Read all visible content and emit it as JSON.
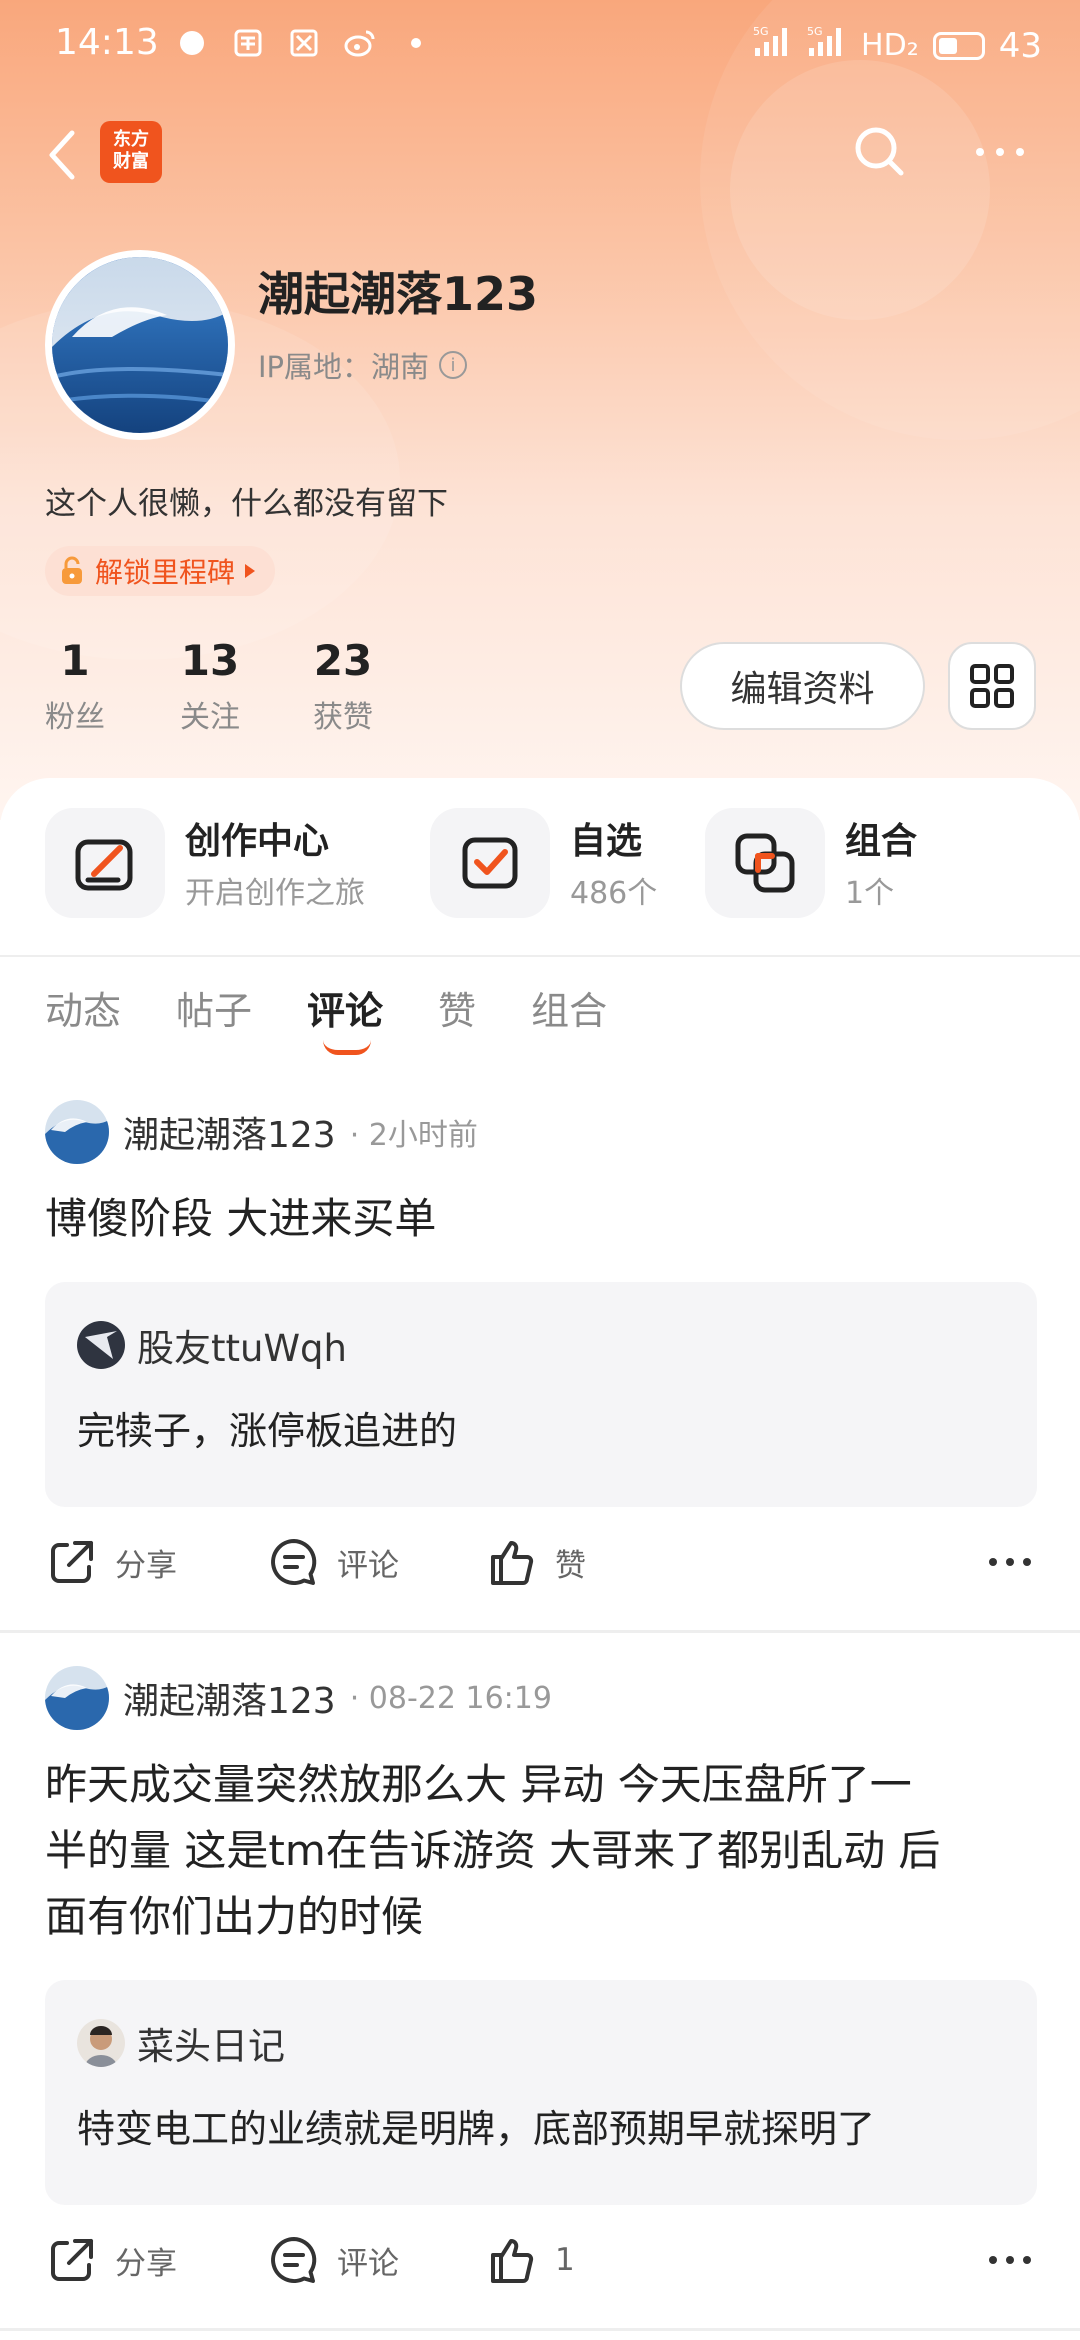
{
  "status_bar": {
    "time": "14:13",
    "net1": "5G",
    "net2": "5G",
    "hd": "HD₂",
    "battery": "43"
  },
  "brand": {
    "logo_line1": "东方",
    "logo_line2": "财富"
  },
  "profile": {
    "username": "潮起潮落123",
    "ip_location": "IP属地：湖南",
    "bio": "这个人很懒，什么都没有留下",
    "milestone": "解锁里程碑"
  },
  "stats": [
    {
      "num": "1",
      "label": "粉丝"
    },
    {
      "num": "13",
      "label": "关注"
    },
    {
      "num": "23",
      "label": "获赞"
    }
  ],
  "buttons": {
    "edit_profile": "编辑资料"
  },
  "quick": [
    {
      "title": "创作中心",
      "sub": "开启创作之旅"
    },
    {
      "title": "自选",
      "sub": "486个"
    },
    {
      "title": "组合",
      "sub": "1个"
    }
  ],
  "tabs": [
    "动态",
    "帖子",
    "评论",
    "赞",
    "组合"
  ],
  "active_tab": "评论",
  "posts": [
    {
      "author": "潮起潮落123",
      "time": "· 2小时前",
      "body": "博傻阶段 大进来买单",
      "quote_author": "股友ttuWqh",
      "quote_text": "完犊子，涨停板追进的",
      "share": "分享",
      "comment": "评论",
      "like": "赞"
    },
    {
      "author": "潮起潮落123",
      "time": "· 08-22 16:19",
      "body_lines": [
        "昨天成交量突然放那么大 异动 今天压盘所了一",
        "半的量 这是tm在告诉游资 大哥来了都别乱动 后",
        "面有你们出力的时候"
      ],
      "quote_author": "菜头日记",
      "quote_text": "特变电工的业绩就是明牌，底部预期早就探明了",
      "share": "分享",
      "comment": "评论",
      "like": "1"
    }
  ],
  "colors": {
    "accent": "#f0541e",
    "hero_top": "#f9a77c",
    "muted": "#8a8a8a"
  }
}
